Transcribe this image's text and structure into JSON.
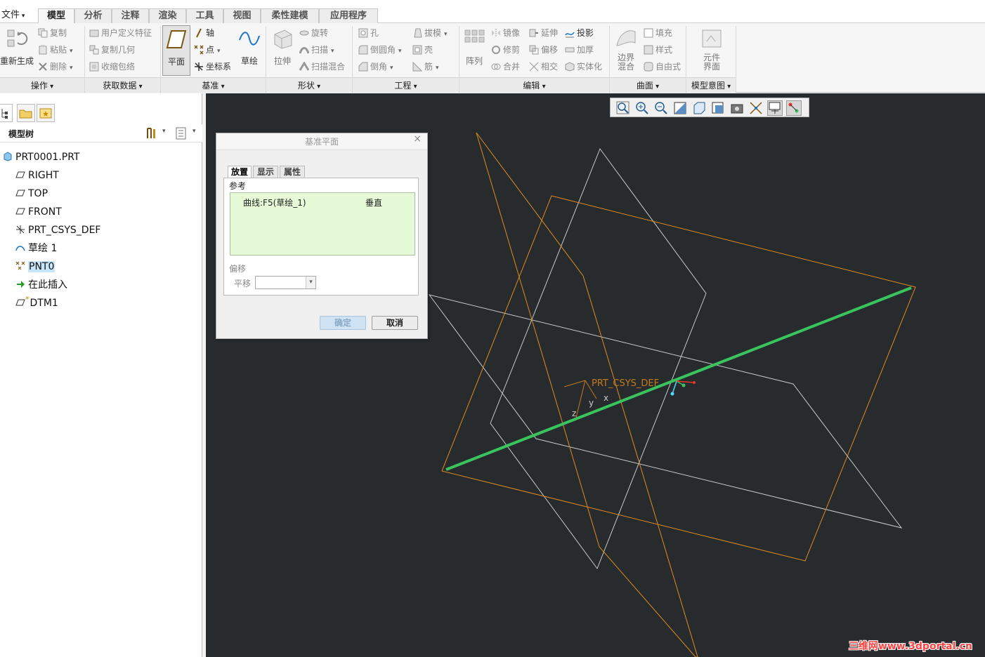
{
  "menu": {
    "file_label": "文件"
  },
  "tabs": [
    {
      "label": "模型",
      "active": true
    },
    {
      "label": "分析"
    },
    {
      "label": "注释"
    },
    {
      "label": "渲染"
    },
    {
      "label": "工具"
    },
    {
      "label": "视图"
    },
    {
      "label": "柔性建模"
    },
    {
      "label": "应用程序"
    }
  ],
  "ribbon": {
    "ops": {
      "label": "操作",
      "regen": "重新生成",
      "copy": "复制",
      "paste": "粘贴",
      "delete": "删除"
    },
    "getdata": {
      "label": "获取数据",
      "udf": "用户定义特征",
      "copygeom": "复制几何",
      "shrinkwrap": "收缩包络"
    },
    "datum": {
      "label": "基准",
      "plane": "平面",
      "axis": "轴",
      "point": "点",
      "csys": "坐标系",
      "sketch": "草绘"
    },
    "shapes": {
      "label": "形状",
      "extrude": "拉伸",
      "revolve": "旋转",
      "sweep": "扫描",
      "sweptblend": "扫描混合"
    },
    "eng": {
      "label": "工程",
      "hole": "孔",
      "round": "倒圆角",
      "chamfer": "倒角",
      "draft": "拔模",
      "shell": "壳",
      "rib": "筋"
    },
    "edit": {
      "label": "编辑",
      "pattern": "阵列",
      "mirror": "镜像",
      "trim": "修剪",
      "merge": "合并",
      "extend": "延伸",
      "offset": "偏移",
      "intersect": "相交",
      "project": "投影",
      "thicken": "加厚",
      "solidify": "实体化"
    },
    "surfaces": {
      "label": "曲面",
      "boundary": "边界混合",
      "fill": "填充",
      "style": "样式",
      "freestyle": "自由式"
    },
    "intent": {
      "label": "模型意图",
      "component": "元件界面"
    }
  },
  "tree": {
    "header": "模型树",
    "items": [
      {
        "label": "PRT0001.PRT",
        "icon": "part-icon"
      },
      {
        "label": "RIGHT",
        "icon": "datum-plane-icon"
      },
      {
        "label": "TOP",
        "icon": "datum-plane-icon"
      },
      {
        "label": "FRONT",
        "icon": "datum-plane-icon"
      },
      {
        "label": "PRT_CSYS_DEF",
        "icon": "csys-icon"
      },
      {
        "label": "草绘 1",
        "icon": "sketch-icon"
      },
      {
        "label": "PNT0",
        "icon": "datum-point-icon",
        "selected": true
      },
      {
        "label": "在此插入",
        "icon": "insert-arrow-icon"
      },
      {
        "label": "DTM1",
        "icon": "datum-plane-new-icon"
      }
    ]
  },
  "dialog": {
    "title": "基准平面",
    "tabs": [
      "放置",
      "显示",
      "属性"
    ],
    "refs_label": "参考",
    "ref_item": "曲线:F5(草绘_1)",
    "ref_constraint": "垂直",
    "offset_label": "偏移",
    "translate_label": "平移",
    "translate_value": "",
    "ok": "确定",
    "cancel": "取消"
  },
  "viewport": {
    "csys_label": "PRT_CSYS_DEF",
    "axis_x": "x",
    "axis_y": "y",
    "axis_z": "z",
    "colors": {
      "background": "#272b2e",
      "datum_plane_orange": "#e08a1e",
      "datum_plane_white": "#c8c8c8",
      "sketch_curve": "#3ac45e"
    }
  },
  "watermark": "三维网www.3dportal.cn"
}
